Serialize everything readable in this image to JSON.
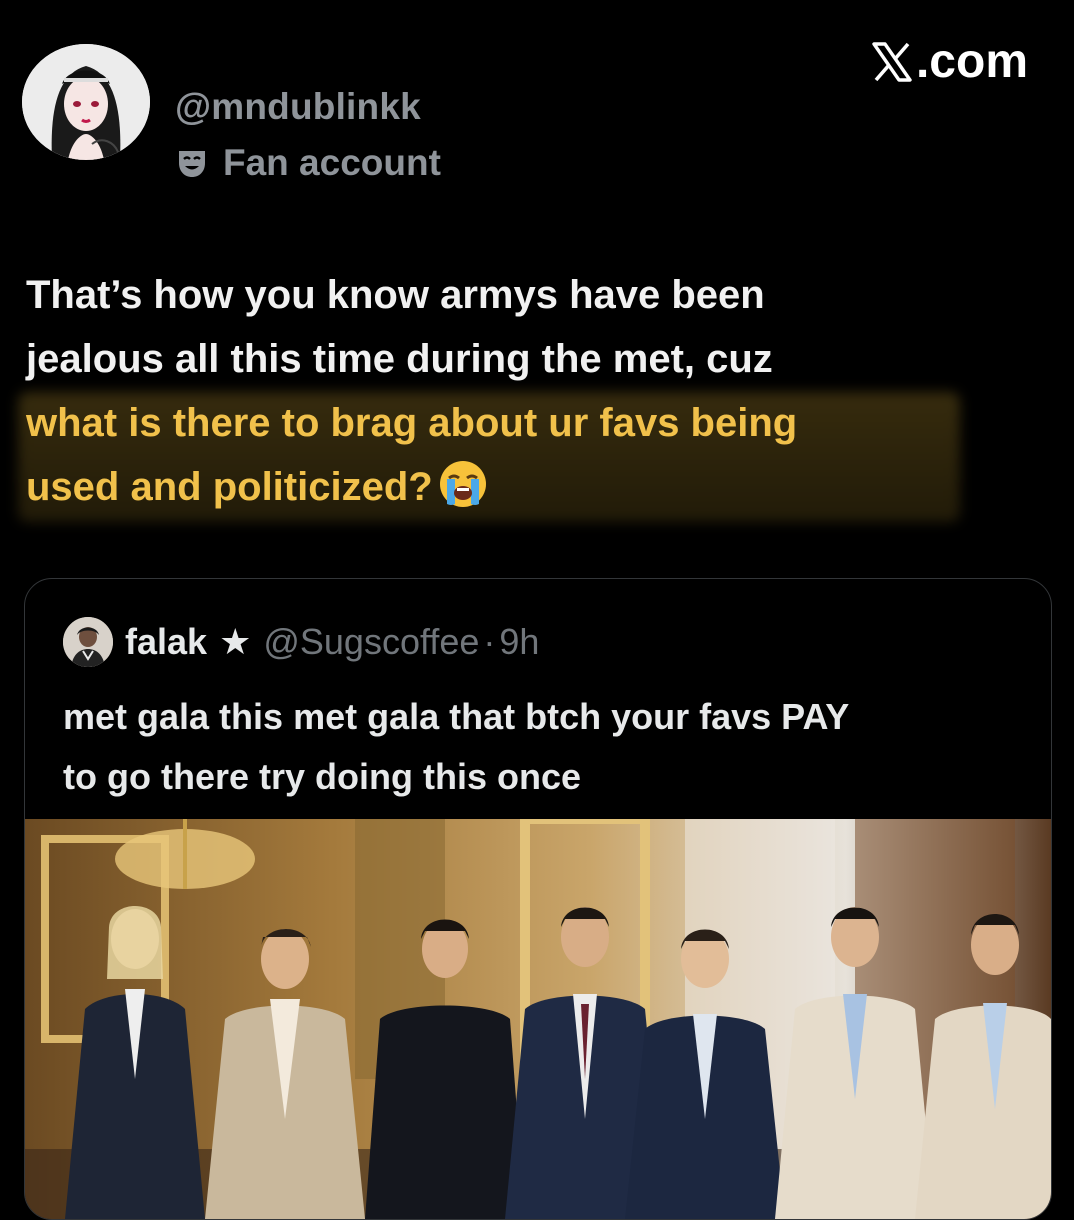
{
  "author": {
    "handle": "@mndublinkk",
    "label_icon": "theater-mask-icon",
    "label": "Fan account",
    "avatar_icon": "anime-girl-avatar"
  },
  "brand": {
    "text": ".com",
    "icon": "x-logo-icon"
  },
  "tweet": {
    "lines": [
      "That’s how you know armys have been",
      "jealous all this time during the met, cuz"
    ],
    "highlighted_lines": [
      "what is there to brag about ur favs being",
      "used and politicized?"
    ],
    "emoji": "loudly-crying-face-emoji"
  },
  "quote": {
    "name": "falak",
    "star": "★",
    "handle": "@Sugscoffee",
    "separator": "·",
    "time": "9h",
    "lines": [
      "met gala this met gala that btch your favs PAY",
      "to go there try doing this once"
    ],
    "media": "group-photo-seven-men-in-suits"
  },
  "colors": {
    "background": "#000000",
    "text": "#f1f1f1",
    "muted": "#8f949a",
    "highlight": "#f1c14b",
    "border": "#333639"
  }
}
